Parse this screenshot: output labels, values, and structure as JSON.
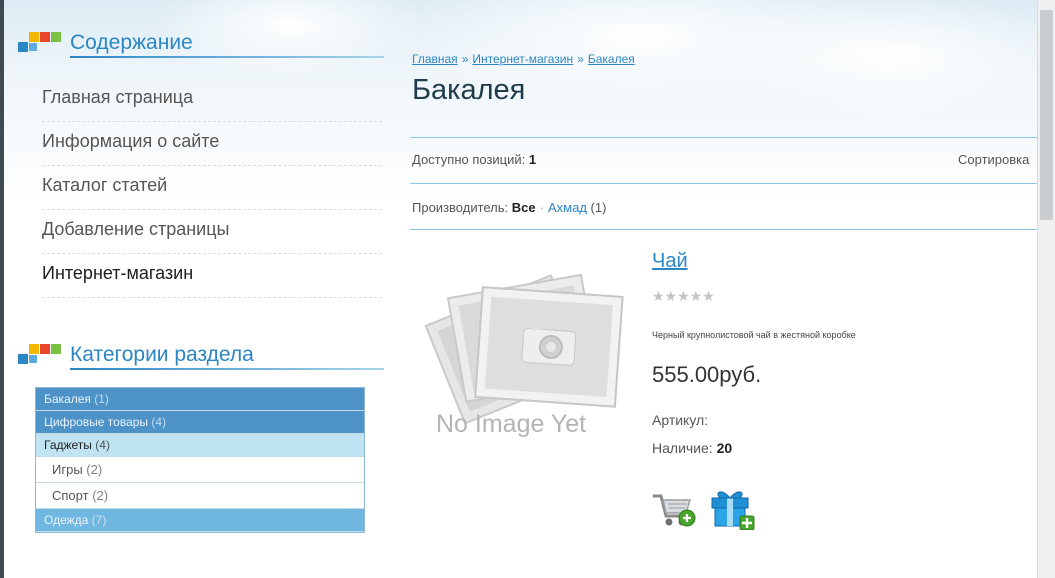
{
  "sidebar": {
    "contents_title": "Содержание",
    "menu": [
      {
        "label": "Главная страница"
      },
      {
        "label": "Информация о сайте"
      },
      {
        "label": "Каталог статей"
      },
      {
        "label": "Добавление страницы"
      },
      {
        "label": "Интернет-магазин"
      }
    ],
    "categories_title": "Категории раздела",
    "categories": [
      {
        "name": "Бакалея",
        "count": "(1)"
      },
      {
        "name": "Цифровые товары",
        "count": "(4)"
      },
      {
        "name": "Гаджеты",
        "count": "(4)"
      },
      {
        "name": "Игры",
        "count": "(2)"
      },
      {
        "name": "Спорт",
        "count": "(2)"
      },
      {
        "name": "Одежда",
        "count": "(7)"
      }
    ]
  },
  "breadcrumb": {
    "items": [
      "Главная",
      "Интернет-магазин",
      "Бакалея"
    ],
    "separator": "»"
  },
  "page_title": "Бакалея",
  "listing": {
    "available_label": "Доступно позиций:",
    "available_count": "1",
    "sort_label": "Сортировка",
    "maker_label": "Производитель:",
    "maker_all": "Все",
    "maker_sep": "·",
    "maker_name": "Ахмад",
    "maker_count": "(1)"
  },
  "product": {
    "no_image_text": "No Image Yet",
    "name": "Чай",
    "stars": "★★★★★",
    "description": "Черный крупнолистовой чай в жестяной коробке",
    "price": "555.00руб.",
    "sku_label": "Артикул:",
    "stock_label": "Наличие:",
    "stock_value": "20"
  },
  "colors": {
    "accent": "#2b86c4",
    "category_dark": "#4d93c7",
    "category_light": "#bfe3f0"
  },
  "icons": {
    "cart": "cart-add-icon",
    "gift": "gift-add-icon"
  }
}
